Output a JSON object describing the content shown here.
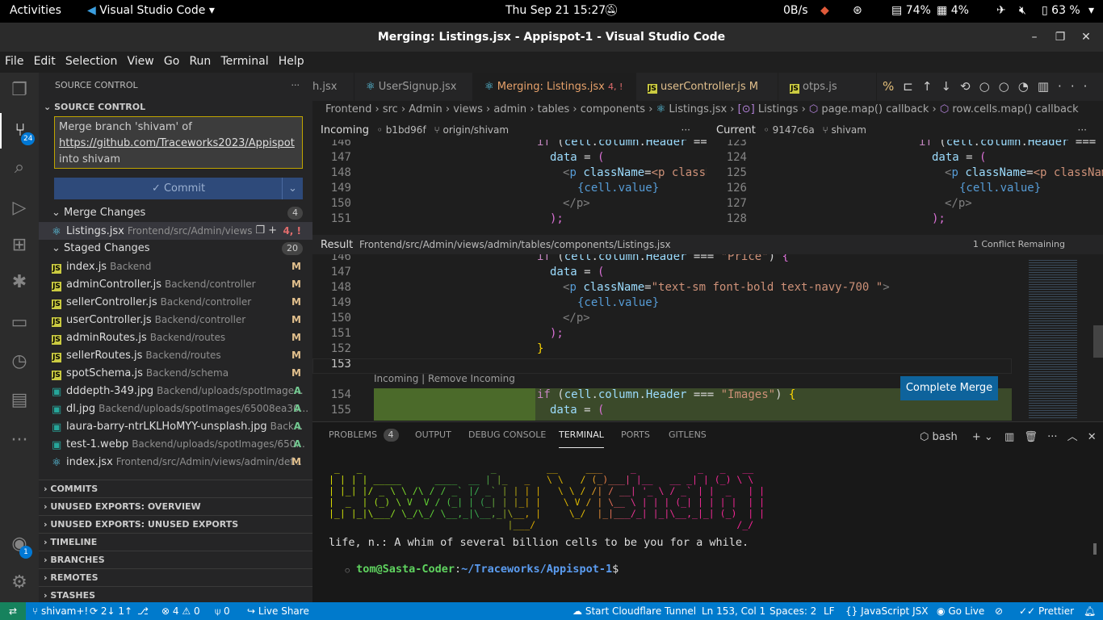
{
  "topbar": {
    "activities": "Activities",
    "app": "Visual Studio Code",
    "datetime": "Thu Sep 21  15:27",
    "net": "0B/s",
    "cpu": "74%",
    "mem": "4%",
    "battery": "63 %"
  },
  "window": {
    "title": "Merging: Listings.jsx - Appispot-1 - Visual Studio Code"
  },
  "menu": [
    "File",
    "Edit",
    "Selection",
    "View",
    "Go",
    "Run",
    "Terminal",
    "Help"
  ],
  "activity": {
    "scm_badge": "24",
    "account_badge": "1"
  },
  "sidebar": {
    "header": "SOURCE CONTROL",
    "section": "SOURCE CONTROL",
    "commit_msg_1": "Merge branch 'shivam' of",
    "commit_msg_link": "https://github.com/Traceworks2023/Appispot",
    "commit_msg_3": "into shivam",
    "commit_label": "Commit",
    "merge_changes": {
      "label": "Merge Changes",
      "count": "4"
    },
    "merge_file": {
      "name": "Listings.jsx",
      "path": "Frontend/src/Admin/views...",
      "status": "4, !"
    },
    "staged": {
      "label": "Staged Changes",
      "count": "20"
    },
    "staged_files": [
      {
        "name": "index.js",
        "path": "Backend",
        "status": "M",
        "icon": "js"
      },
      {
        "name": "adminController.js",
        "path": "Backend/controller",
        "status": "M",
        "icon": "js"
      },
      {
        "name": "sellerController.js",
        "path": "Backend/controller",
        "status": "M",
        "icon": "js"
      },
      {
        "name": "userController.js",
        "path": "Backend/controller",
        "status": "M",
        "icon": "js"
      },
      {
        "name": "adminRoutes.js",
        "path": "Backend/routes",
        "status": "M",
        "icon": "js"
      },
      {
        "name": "sellerRoutes.js",
        "path": "Backend/routes",
        "status": "M",
        "icon": "js"
      },
      {
        "name": "spotSchema.js",
        "path": "Backend/schema",
        "status": "M",
        "icon": "js"
      },
      {
        "name": "dddepth-349.jpg",
        "path": "Backend/uploads/spotImage...",
        "status": "A",
        "icon": "img"
      },
      {
        "name": "dl.jpg",
        "path": "Backend/uploads/spotImages/65008ea30...",
        "status": "A",
        "icon": "img"
      },
      {
        "name": "laura-barry-ntrLKLHoMYY-unsplash.jpg",
        "path": "Back...",
        "status": "A",
        "icon": "img"
      },
      {
        "name": "test-1.webp",
        "path": "Backend/uploads/spotImages/650...",
        "status": "A",
        "icon": "img"
      },
      {
        "name": "index.jsx",
        "path": "Frontend/src/Admin/views/admin/def...",
        "status": "M",
        "icon": "jsx"
      }
    ],
    "collapsed": [
      "COMMITS",
      "UNUSED EXPORTS: OVERVIEW",
      "UNUSED EXPORTS: UNUSED EXPORTS",
      "TIMELINE",
      "BRANCHES",
      "REMOTES",
      "STASHES"
    ]
  },
  "tabs": [
    {
      "label": "h.jsx"
    },
    {
      "label": "UserSignup.jsx"
    },
    {
      "label": "Merging: Listings.jsx",
      "status": "4, !"
    },
    {
      "label": "userController.js",
      "status": "M"
    },
    {
      "label": "otps.js"
    }
  ],
  "breadcrumb": [
    "Frontend",
    "src",
    "Admin",
    "views",
    "admin",
    "tables",
    "components",
    "Listings.jsx",
    "Listings",
    "page.map() callback",
    "row.cells.map() callback"
  ],
  "incoming": {
    "label": "Incoming",
    "hash": "b1bd96f",
    "ref": "origin/shivam"
  },
  "current": {
    "label": "Current",
    "hash": "9147c6a",
    "ref": "shivam"
  },
  "incoming_lines": [
    "146",
    "147",
    "148",
    "149",
    "150",
    "151"
  ],
  "current_lines": [
    "123",
    "124",
    "125",
    "126",
    "127",
    "128"
  ],
  "result": {
    "label": "Result",
    "path": "Frontend/src/Admin/views/admin/tables/components/Listings.jsx",
    "remaining": "1 Conflict Remaining"
  },
  "result_lines": [
    "146",
    "147",
    "148",
    "149",
    "150",
    "151",
    "152",
    "153"
  ],
  "result_lines_b": [
    "154",
    "155"
  ],
  "code": {
    "l146": "if (cell.column.Header === \"Price\") {",
    "data_eq": "data = (",
    "p_open": "<p className=\"text-sm font-bold text-navy-700 \">",
    "p_open_short": "<p className=\"text-sm",
    "p_open_short2": "<p className=\"text-sm f",
    "cell_value": "{cell.value}",
    "p_close": "</p>",
    "close_paren": ");",
    "close_brace": "}",
    "l154": "if (cell.column.Header === \"Images\") {",
    "l155": "data = ("
  },
  "conflict_actions": "Incoming | Remove Incoming",
  "complete_merge": "Complete Merge",
  "panel": {
    "tabs": [
      "PROBLEMS",
      "OUTPUT",
      "DEBUG CONSOLE",
      "TERMINAL",
      "PORTS",
      "GITLENS"
    ],
    "problems_count": "4",
    "shell": "bash",
    "ascii": [
      " _   _                       _         __     ___     _           _   _   __ ",
      "| | | | _____      ____  __ | |_   _   \\ \\   / (_)___| |__   __ _| | (_) \\ \\",
      "| |_| |/ _ \\ \\ /\\ / / _` |/ _` | | | |   \\ \\ / /| / __| '_ \\ / _` | |  _   | |",
      "|  _  | (_) \\ V  V / (_| | (_| | |_| |    \\ V / | \\__ \\ | | | (_| | | | |  | |",
      "|_| |_|\\___/ \\_/\\_/ \\__,_|\\__,_|\\__, |     \\_/  |_|___/_| |_|\\__,_|_| (_)  | |",
      "                                |___/                                    /_/ "
    ],
    "fortune": "life, n.: A whim of several billion cells to be you for a while.",
    "prompt_user": "tom@Sasta-Coder",
    "prompt_path": "~/Traceworks/Appispot-1"
  },
  "status": {
    "branch": "shivam+!",
    "sync": "2↓ 1↑",
    "errors": "4",
    "warnings": "0",
    "ports": "0",
    "liveshare": "Live Share",
    "cloudflare": "Start Cloudflare Tunnel",
    "position": "Ln 153, Col 1",
    "spaces": "Spaces: 2",
    "eol": "LF",
    "lang": "JavaScript JSX",
    "golive": "Go Live",
    "prettier": "Prettier"
  }
}
